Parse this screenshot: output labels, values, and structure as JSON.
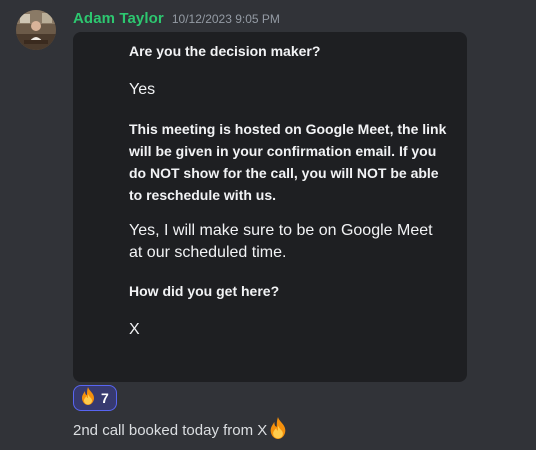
{
  "message": {
    "author": "Adam Taylor",
    "timestamp": "10/12/2023 9:05 PM",
    "author_color": "#2dc770",
    "text": "2nd call booked today from X",
    "inline_emoji": "fire-icon"
  },
  "form": {
    "items": [
      {
        "question": "Are you the decision maker?",
        "answer": "Yes"
      },
      {
        "question": "This meeting is hosted on Google Meet, the link will be given in your confirmation email. If you do NOT show for the call, you will NOT be able to reschedule with us.",
        "answer": "Yes, I will make sure to be on Google Meet at our scheduled time."
      },
      {
        "question": "How did you get here?",
        "answer": "X"
      }
    ]
  },
  "reaction": {
    "emoji": "fire-icon",
    "count": "7",
    "accent": "#5865f2"
  }
}
